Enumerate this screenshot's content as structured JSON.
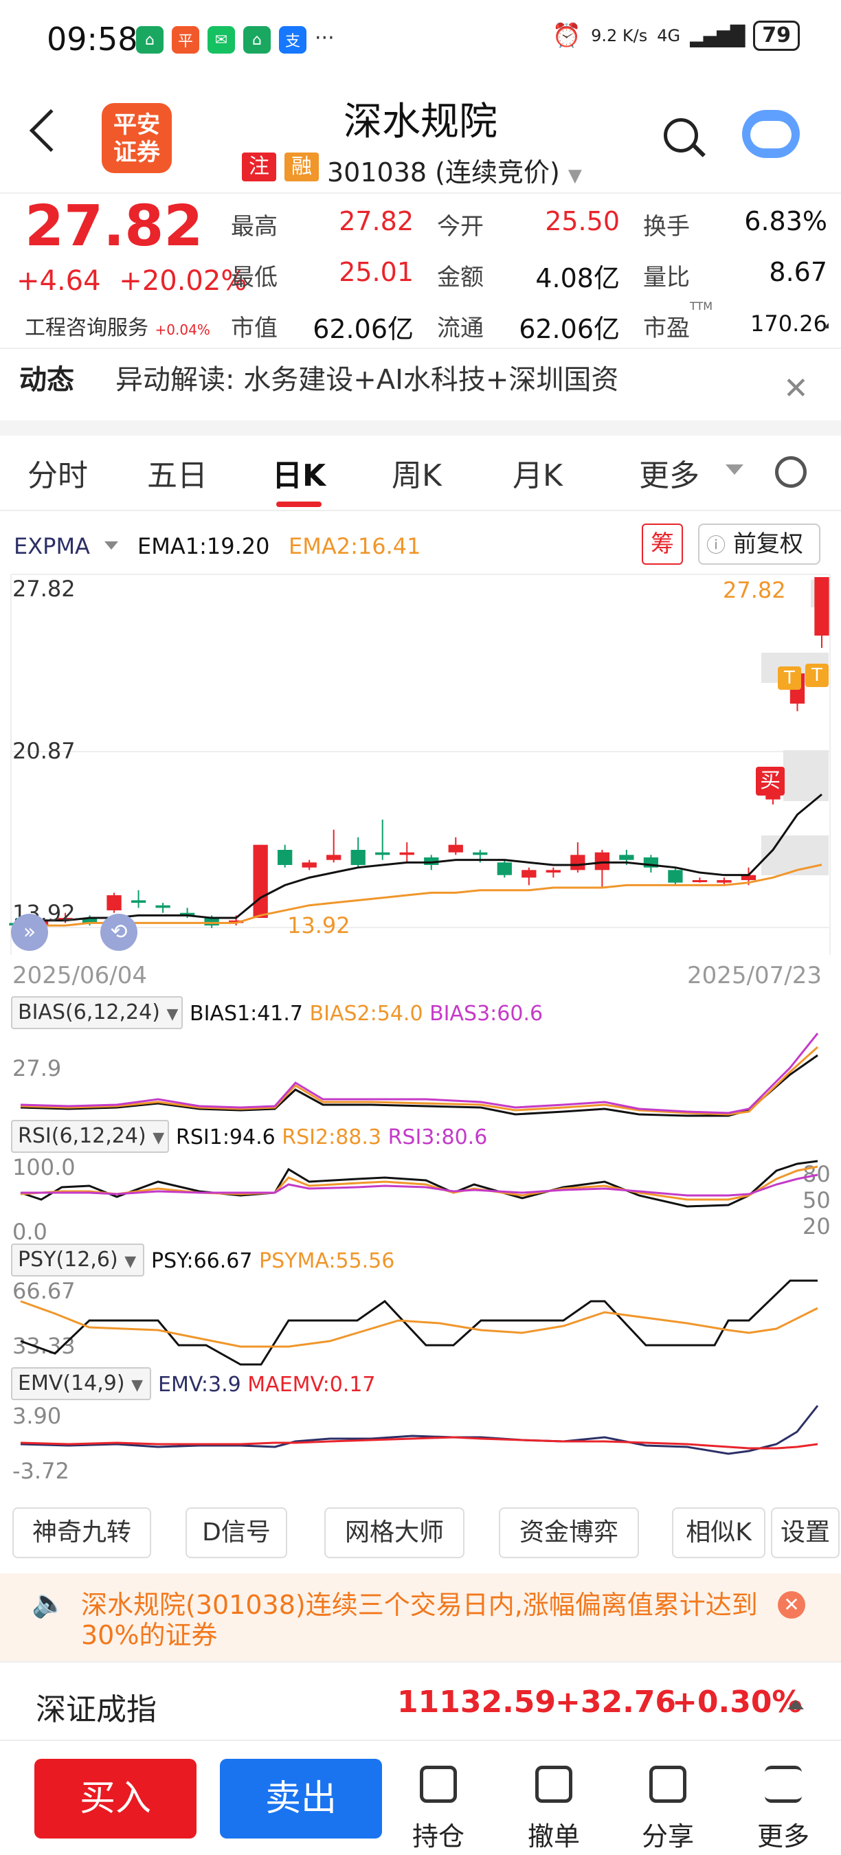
{
  "status_bar": {
    "time": "09:58",
    "net_speed": "9.2 K/s",
    "network": "4G",
    "battery": "79"
  },
  "header": {
    "stock_name": "深水规院",
    "logo_text": "平安证券",
    "tag_zhu": "注",
    "tag_rong": "融",
    "code_text": "301038 (连续竞价)"
  },
  "quote": {
    "price": "27.82",
    "change": "+4.64",
    "change_pct": "+20.02%",
    "industry": "工程咨询服务",
    "industry_pct": "+0.04%",
    "rows": [
      [
        {
          "label": "最高",
          "value": "27.82",
          "color": "red"
        },
        {
          "label": "今开",
          "value": "25.50",
          "color": "red"
        },
        {
          "label": "换手",
          "value": "6.83%",
          "color": "black"
        }
      ],
      [
        {
          "label": "最低",
          "value": "25.01",
          "color": "red"
        },
        {
          "label": "金额",
          "value": "4.08亿",
          "color": "black"
        },
        {
          "label": "量比",
          "value": "8.67",
          "color": "black"
        }
      ],
      [
        {
          "label": "市值",
          "value": "62.06亿",
          "color": "black"
        },
        {
          "label": "流通",
          "value": "62.06亿",
          "color": "black"
        },
        {
          "label": "市盈",
          "value": "170.26",
          "color": "black"
        }
      ]
    ],
    "pe_sup": "TTM"
  },
  "news": {
    "label": "动态",
    "text": "异动解读:  水务建设+AI水科技+深圳国资"
  },
  "tabs": [
    "分时",
    "五日",
    "日K",
    "周K",
    "月K",
    "更多"
  ],
  "active_tab": "日K",
  "chart_header": {
    "indicator": "EXPMA",
    "ema1": "EMA1:19.20",
    "ema2": "EMA2:16.41",
    "chou": "筹",
    "fuquan": "前复权"
  },
  "chart_labels": {
    "y_top": "27.82",
    "y_mid": "20.87",
    "y_low": "13.92",
    "high_marker": "27.82",
    "low_marker": "13.92",
    "date_start": "2025/06/04",
    "date_end": "2025/07/23",
    "buy_marker": "买",
    "t_marker": "T"
  },
  "chart_data": {
    "type": "candlestick",
    "x": [
      "2025/06/04",
      "2025/07/23"
    ],
    "ylim": [
      13.92,
      27.82
    ],
    "candles": [
      {
        "o": 14.1,
        "c": 14.0,
        "h": 14.3,
        "l": 13.9
      },
      {
        "o": 14.0,
        "c": 14.2,
        "h": 14.3,
        "l": 13.9
      },
      {
        "o": 14.2,
        "c": 14.3,
        "h": 14.5,
        "l": 14.1
      },
      {
        "o": 14.3,
        "c": 14.1,
        "h": 14.4,
        "l": 14.0
      },
      {
        "o": 14.6,
        "c": 15.2,
        "h": 15.3,
        "l": 14.5
      },
      {
        "o": 15.0,
        "c": 14.9,
        "h": 15.4,
        "l": 14.7
      },
      {
        "o": 14.8,
        "c": 14.7,
        "h": 14.9,
        "l": 14.5
      },
      {
        "o": 14.5,
        "c": 14.4,
        "h": 14.7,
        "l": 14.3
      },
      {
        "o": 14.3,
        "c": 14.0,
        "h": 14.4,
        "l": 13.9
      },
      {
        "o": 14.1,
        "c": 14.2,
        "h": 14.4,
        "l": 14.0
      },
      {
        "o": 14.3,
        "c": 17.2,
        "h": 17.2,
        "l": 14.3
      },
      {
        "o": 17.0,
        "c": 16.4,
        "h": 17.2,
        "l": 16.3
      },
      {
        "o": 16.3,
        "c": 16.5,
        "h": 16.6,
        "l": 16.2
      },
      {
        "o": 16.6,
        "c": 16.8,
        "h": 17.8,
        "l": 16.5
      },
      {
        "o": 17.0,
        "c": 16.4,
        "h": 17.5,
        "l": 16.3
      },
      {
        "o": 16.9,
        "c": 16.8,
        "h": 18.2,
        "l": 16.6
      },
      {
        "o": 16.8,
        "c": 16.9,
        "h": 17.3,
        "l": 16.5
      },
      {
        "o": 16.7,
        "c": 16.4,
        "h": 16.8,
        "l": 16.2
      },
      {
        "o": 16.9,
        "c": 17.2,
        "h": 17.5,
        "l": 16.8
      },
      {
        "o": 16.9,
        "c": 16.8,
        "h": 17.0,
        "l": 16.5
      },
      {
        "o": 16.5,
        "c": 16.0,
        "h": 16.6,
        "l": 15.9
      },
      {
        "o": 15.9,
        "c": 16.2,
        "h": 16.3,
        "l": 15.6
      },
      {
        "o": 16.1,
        "c": 16.2,
        "h": 16.3,
        "l": 15.9
      },
      {
        "o": 16.2,
        "c": 16.8,
        "h": 17.3,
        "l": 16.1
      },
      {
        "o": 16.2,
        "c": 16.9,
        "h": 17.0,
        "l": 15.5
      },
      {
        "o": 16.8,
        "c": 16.6,
        "h": 17.0,
        "l": 16.4
      },
      {
        "o": 16.7,
        "c": 16.3,
        "h": 16.8,
        "l": 16.1
      },
      {
        "o": 16.2,
        "c": 15.7,
        "h": 16.3,
        "l": 15.6
      },
      {
        "o": 15.8,
        "c": 15.8,
        "h": 15.9,
        "l": 15.7
      },
      {
        "o": 15.7,
        "c": 15.8,
        "h": 15.9,
        "l": 15.6
      },
      {
        "o": 15.8,
        "c": 16.0,
        "h": 16.3,
        "l": 15.6
      },
      {
        "o": 19.0,
        "c": 20.0,
        "h": 20.2,
        "l": 18.8
      },
      {
        "o": 22.8,
        "c": 24.0,
        "h": 24.0,
        "l": 22.5
      },
      {
        "o": 25.5,
        "c": 27.82,
        "h": 27.82,
        "l": 25.01
      }
    ],
    "ema1": [
      14.2,
      14.2,
      14.2,
      14.3,
      14.3,
      14.4,
      14.4,
      14.4,
      14.3,
      14.3,
      15.1,
      15.6,
      15.9,
      16.1,
      16.3,
      16.4,
      16.5,
      16.5,
      16.6,
      16.6,
      16.6,
      16.5,
      16.4,
      16.4,
      16.5,
      16.5,
      16.4,
      16.3,
      16.1,
      16.0,
      16.0,
      17.0,
      18.4,
      19.2
    ],
    "ema2": [
      14.0,
      14.0,
      14.0,
      14.1,
      14.1,
      14.1,
      14.1,
      14.1,
      14.1,
      14.1,
      14.4,
      14.6,
      14.8,
      14.9,
      15.0,
      15.1,
      15.2,
      15.3,
      15.3,
      15.4,
      15.4,
      15.4,
      15.5,
      15.5,
      15.5,
      15.6,
      15.6,
      15.6,
      15.6,
      15.6,
      15.7,
      15.9,
      16.2,
      16.41
    ]
  },
  "indicators": [
    {
      "name": "BIAS(6,12,24)",
      "values": [
        {
          "text": "BIAS1:41.7",
          "color": "#111"
        },
        {
          "text": "BIAS2:54.0",
          "color": "#f0962a"
        },
        {
          "text": "BIAS3:60.6",
          "color": "#c43ac8"
        }
      ],
      "axis_labels": [
        "27.9"
      ]
    },
    {
      "name": "RSI(6,12,24)",
      "values": [
        {
          "text": "RSI1:94.6",
          "color": "#111"
        },
        {
          "text": "RSI2:88.3",
          "color": "#f0962a"
        },
        {
          "text": "RSI3:80.6",
          "color": "#c43ac8"
        }
      ],
      "axis_labels": [
        "100.0",
        "0.0",
        "80",
        "50",
        "20"
      ]
    },
    {
      "name": "PSY(12,6)",
      "values": [
        {
          "text": "PSY:66.67",
          "color": "#111"
        },
        {
          "text": "PSYMA:55.56",
          "color": "#f0962a"
        }
      ],
      "axis_labels": [
        "66.67",
        "33.33"
      ]
    },
    {
      "name": "EMV(14,9)",
      "values": [
        {
          "text": "EMV:3.9",
          "color": "#2c2f66"
        },
        {
          "text": "MAEMV:0.17",
          "color": "#e9242b"
        }
      ],
      "axis_labels": [
        "3.90",
        "-3.72"
      ]
    }
  ],
  "features": [
    "神奇九转",
    "D信号",
    "网格大师",
    "资金博弈",
    "相似K",
    "设置"
  ],
  "alert": {
    "text": "深水规院(301038)连续三个交易日内,涨幅偏离值累计达到30%的证券"
  },
  "index": {
    "name": "深证成指",
    "value": "11132.59",
    "change": "+32.76",
    "pct": "+0.30%"
  },
  "bottom_bar": {
    "buy": "买入",
    "sell": "卖出",
    "items": [
      "持仓",
      "撤单",
      "分享",
      "更多"
    ]
  },
  "colors": {
    "up": "#e9242b",
    "down": "#0e9e6a",
    "ema1": "#111111",
    "ema2": "#f0962a",
    "sell_button": "#1a74f0"
  }
}
